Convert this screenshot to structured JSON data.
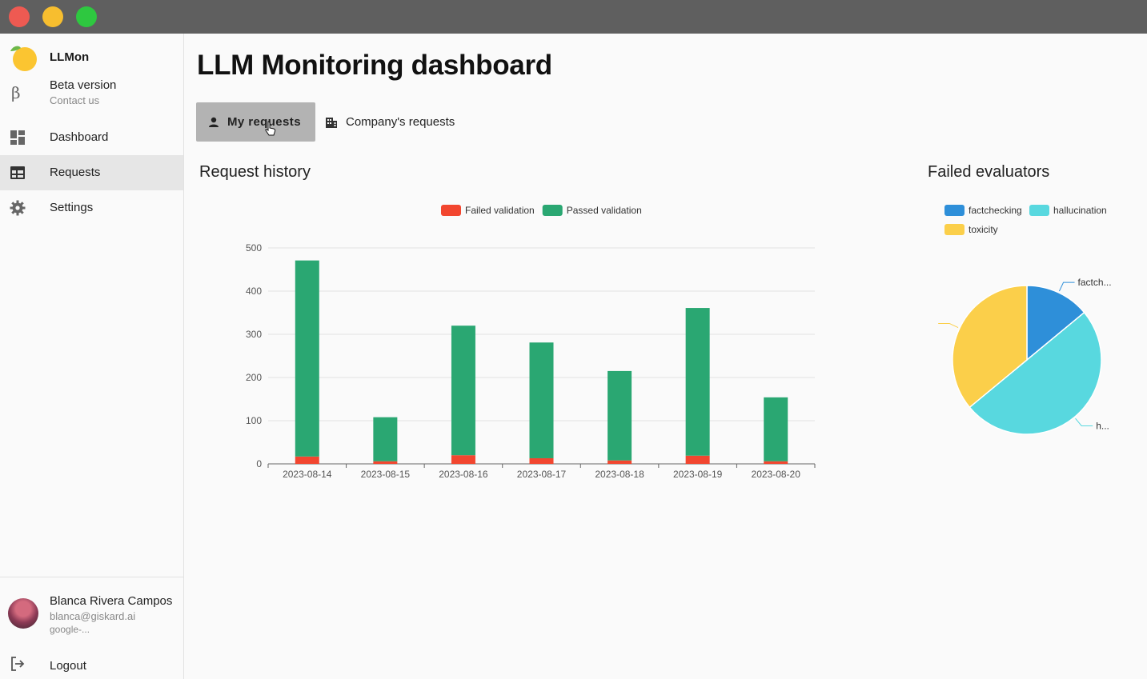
{
  "window": {
    "controls": [
      "close",
      "minimize",
      "maximize"
    ]
  },
  "sidebar": {
    "brand": {
      "name": "LLMon"
    },
    "beta": {
      "title": "Beta version",
      "subtitle": "Contact us"
    },
    "items": [
      {
        "label": "Dashboard",
        "icon": "dashboard-icon",
        "active": false
      },
      {
        "label": "Requests",
        "icon": "table-icon",
        "active": true
      },
      {
        "label": "Settings",
        "icon": "gear-icon",
        "active": false
      }
    ],
    "user": {
      "name": "Blanca Rivera Campos",
      "email": "blanca@giskard.ai",
      "provider": "google-..."
    },
    "logout_label": "Logout"
  },
  "main": {
    "title": "LLM Monitoring dashboard",
    "tabs": [
      {
        "label": "My requests",
        "icon": "person-icon",
        "selected": true
      },
      {
        "label": "Company's requests",
        "icon": "building-icon",
        "selected": false
      }
    ],
    "request_history_title": "Request history",
    "failed_evaluators_title": "Failed evaluators"
  },
  "colors": {
    "failed": "#f2462f",
    "passed": "#2aa772",
    "factchecking": "#2e8fd9",
    "hallucination": "#58d8df",
    "toxicity": "#fbcf4a"
  },
  "chart_data": [
    {
      "type": "bar",
      "stacked": true,
      "categories": [
        "2023-08-14",
        "2023-08-15",
        "2023-08-16",
        "2023-08-17",
        "2023-08-18",
        "2023-08-19",
        "2023-08-20"
      ],
      "series": [
        {
          "name": "Failed validation",
          "color": "#f2462f",
          "values": [
            17,
            6,
            20,
            13,
            8,
            19,
            6
          ]
        },
        {
          "name": "Passed validation",
          "color": "#2aa772",
          "values": [
            454,
            102,
            300,
            268,
            207,
            342,
            148
          ]
        }
      ],
      "yticks": [
        0,
        100,
        200,
        300,
        400,
        500
      ],
      "ylim": [
        0,
        500
      ],
      "legend": "top-center",
      "grid": true
    },
    {
      "type": "pie",
      "labels": [
        "factchecking",
        "hallucination",
        "toxicity"
      ],
      "slice_labels": [
        "factch...",
        "h...",
        ""
      ],
      "colors": [
        "#2e8fd9",
        "#58d8df",
        "#fbcf4a"
      ],
      "values": [
        14,
        50,
        36
      ],
      "legend": "top"
    }
  ]
}
